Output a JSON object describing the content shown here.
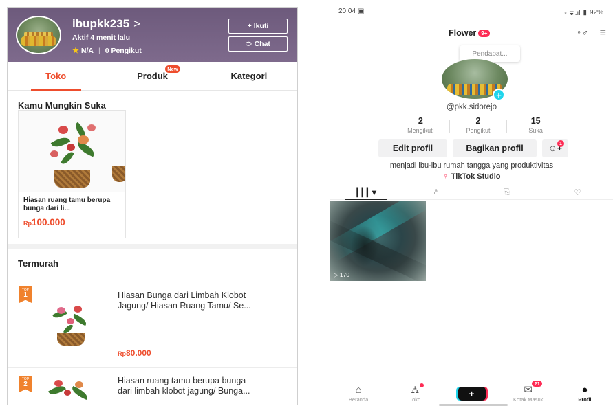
{
  "left": {
    "shop": {
      "name": "ibupkk235",
      "chevron": ">",
      "active": "Aktif 4 menit lalu",
      "rating": "N/A",
      "followers": "0 Pengikut",
      "follow_label": "+ Ikuti",
      "chat_label": "Chat"
    },
    "tabs": [
      {
        "label": "Toko",
        "active": true
      },
      {
        "label": "Produk",
        "badge": "New"
      },
      {
        "label": "Kategori"
      }
    ],
    "recommend": {
      "title": "Kamu Mungkin Suka",
      "item_name": "Hiasan ruang tamu berupa bunga dari li...",
      "price_prefix": "Rp",
      "price": "100.000"
    },
    "cheapest": {
      "title": "Termurah",
      "items": [
        {
          "rank_tag": "TOP",
          "rank": "1",
          "name_line1": "Hiasan Bunga dari Limbah Klobot",
          "name_line2": "Jagung/ Hiasan Ruang Tamu/ Se...",
          "price_prefix": "Rp",
          "price": "80.000"
        },
        {
          "rank_tag": "TOP",
          "rank": "2",
          "name_line1": "Hiasan ruang tamu berupa bunga",
          "name_line2": "dari limbah klobot jagung/ Bunga..."
        }
      ]
    },
    "colors": {
      "accent": "#ee4d2d",
      "header": "#6d5a7c"
    }
  },
  "right": {
    "status": {
      "time": "20.04",
      "battery": "92%"
    },
    "profile": {
      "name": "Flower",
      "name_badge": "9+",
      "tooltip": "Pendapat...",
      "handle": "@pkk.sidorejo",
      "stats": [
        {
          "value": "2",
          "label": "Mengikuti"
        },
        {
          "value": "2",
          "label": "Pengikut"
        },
        {
          "value": "15",
          "label": "Suka"
        }
      ],
      "edit_label": "Edit profil",
      "share_label": "Bagikan profil",
      "add_badge": "1",
      "bio": "menjadi ibu-ibu rumah tangga yang produktivitas",
      "studio": "TikTok Studio"
    },
    "video": {
      "views": "▷ 170"
    },
    "nav": [
      {
        "label": "Beranda",
        "icon": "home-icon"
      },
      {
        "label": "Toko",
        "icon": "shop-icon"
      },
      {
        "label": "",
        "icon": "create-icon"
      },
      {
        "label": "Kotak Masuk",
        "icon": "inbox-icon",
        "badge": "21"
      },
      {
        "label": "Profil",
        "icon": "profile-icon",
        "active": true
      }
    ],
    "colors": {
      "accent": "#fe2c55",
      "cyan": "#20d5ec"
    }
  }
}
